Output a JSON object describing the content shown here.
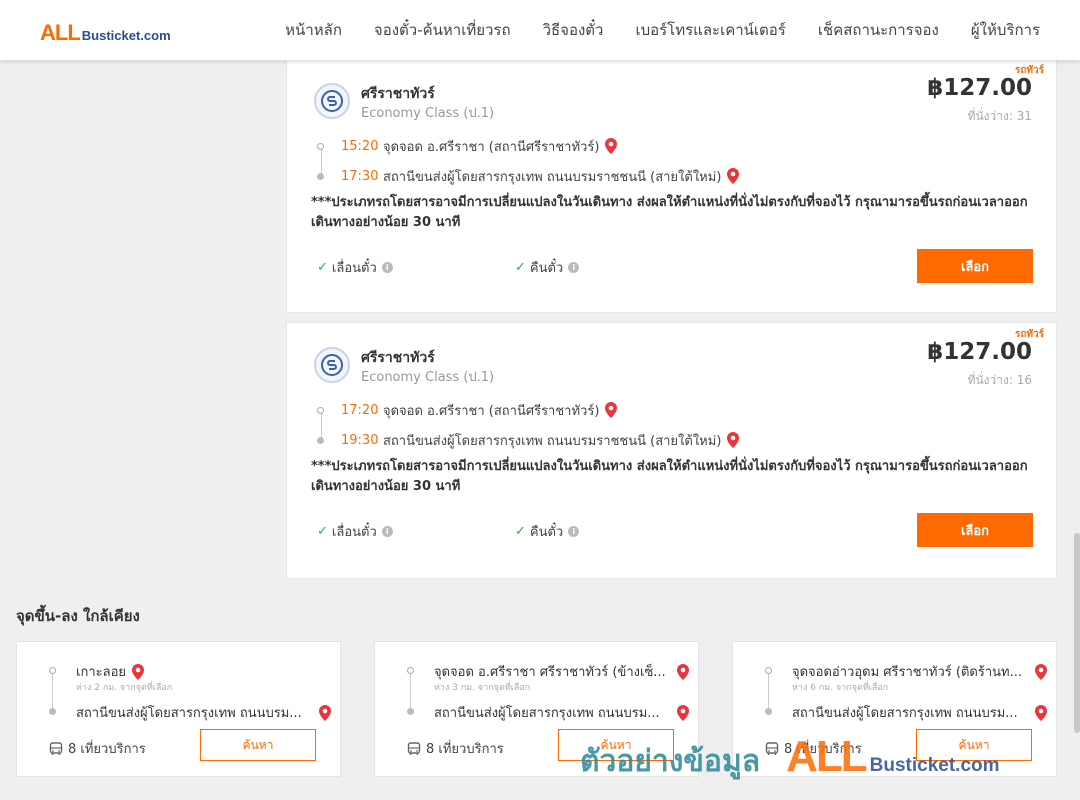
{
  "header": {
    "logo_all": "ALL",
    "logo_busticket": "Busticket.com",
    "nav": [
      "หน้าหลัก",
      "จองตั๋ว-ค้นหาเที่ยวรถ",
      "วิธีจองตั๋ว",
      "เบอร์โทรและเคาน์เตอร์",
      "เช็คสถานะการจอง",
      "ผู้ให้บริการ"
    ]
  },
  "trips": [
    {
      "tag": "รถทัวร์",
      "operator": "ศรีราชาทัวร์",
      "class": "Economy Class (ป.1)",
      "price": "฿127.00",
      "seats": "ที่นั่งว่าง: 31",
      "departure_time": "15:20",
      "departure_stop": "จุดจอด อ.ศรีราชา (สถานีศรีราชาทัวร์)",
      "arrival_time": "17:30",
      "arrival_stop": "สถานีขนส่งผู้โดยสารกรุงเทพ ถนนบรมราชชนนี (สายใต้ใหม่)",
      "notice": "***ประเภทรถโดยสารอาจมีการเปลี่ยนแปลงในวันเดินทาง ส่งผลให้ตำแหน่งที่นั่งไม่ตรงกับที่จองไว้ กรุณามารอขึ้นรถก่อนเวลาออกเดินทางอย่างน้อย 30 นาที",
      "feature_change": "เลื่อนตั๋ว",
      "feature_refund": "คืนตั๋ว",
      "select_label": "เลือก"
    },
    {
      "tag": "รถทัวร์",
      "operator": "ศรีราชาทัวร์",
      "class": "Economy Class (ป.1)",
      "price": "฿127.00",
      "seats": "ที่นั่งว่าง: 16",
      "departure_time": "17:20",
      "departure_stop": "จุดจอด อ.ศรีราชา (สถานีศรีราชาทัวร์)",
      "arrival_time": "19:30",
      "arrival_stop": "สถานีขนส่งผู้โดยสารกรุงเทพ ถนนบรมราชชนนี (สายใต้ใหม่)",
      "notice": "***ประเภทรถโดยสารอาจมีการเปลี่ยนแปลงในวันเดินทาง ส่งผลให้ตำแหน่งที่นั่งไม่ตรงกับที่จองไว้ กรุณามารอขึ้นรถก่อนเวลาออกเดินทางอย่างน้อย 30 นาที",
      "feature_change": "เลื่อนตั๋ว",
      "feature_refund": "คืนตั๋ว",
      "select_label": "เลือก"
    }
  ],
  "nearby": {
    "title": "จุดขึ้น-ลง ใกล้เคียง",
    "cards": [
      {
        "origin": "เกาะลอย",
        "distance": "ห่าง 2 กม. จากจุดที่เลือก",
        "destination": "สถานีขนส่งผู้โดยสารกรุงเทพ ถนนบรม...",
        "trips": "8 เที่ยวบริการ",
        "search_label": "ค้นหา"
      },
      {
        "origin": "จุดจอด อ.ศรีราชา ศรีราชาทัวร์ (ข้างเซ็...",
        "distance": "ห่าง 3 กม. จากจุดที่เลือก",
        "destination": "สถานีขนส่งผู้โดยสารกรุงเทพ ถนนบรม...",
        "trips": "8 เที่ยวบริการ",
        "search_label": "ค้นหา"
      },
      {
        "origin": "จุดจอดอ่าวอุดม ศรีราชาทัวร์ (ติดร้านท...",
        "distance": "ห่าง 6 กม. จากจุดที่เลือก",
        "destination": "สถานีขนส่งผู้โดยสารกรุงเทพ ถนนบรม...",
        "trips": "8 เที่ยวบริการ",
        "search_label": "ค้นหา"
      }
    ]
  },
  "watermark": {
    "text": "ตัวอย่างข้อมูล",
    "all": "ALL",
    "busticket": "Busticket.com"
  },
  "colors": {
    "accent": "#ff6a00",
    "check": "#39a845",
    "pin": "#e8363c",
    "brand_blue": "#2a4d8f",
    "watermark_teal": "#2f8a9a"
  },
  "icons": {
    "pin": "map-pin-icon",
    "check": "check-icon",
    "info": "info-icon",
    "bus": "bus-icon",
    "operator_logo": "operator-logo-icon"
  }
}
